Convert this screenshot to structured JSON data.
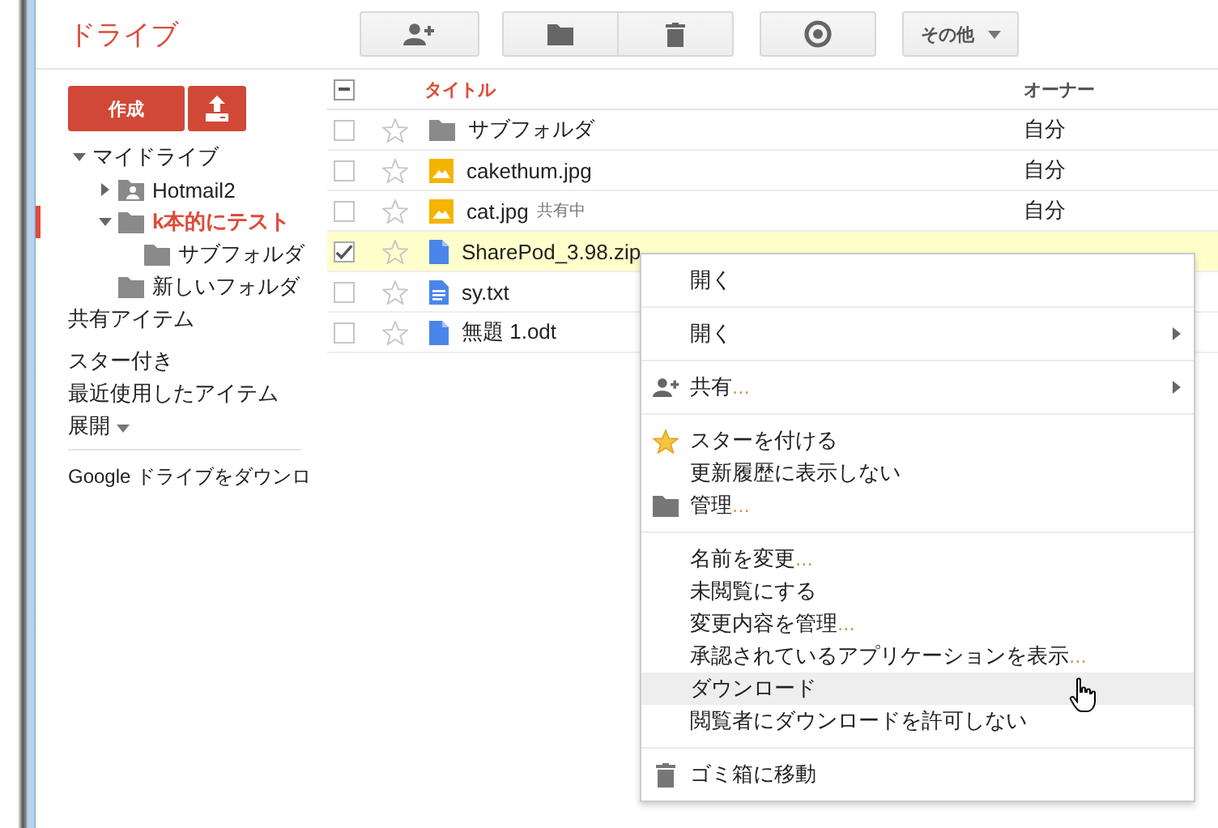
{
  "app": {
    "title": "ドライブ"
  },
  "toolbar": [
    {
      "kind": "share"
    },
    {
      "kind": "folder"
    },
    {
      "kind": "trash"
    },
    {
      "kind": "preview"
    },
    {
      "kind": "more",
      "label": "その他"
    }
  ],
  "sidebar": {
    "create_button": "作成",
    "tree": [
      {
        "label": "マイドライブ",
        "expanded": true,
        "selected": false,
        "children": [
          {
            "label": "Hotmail2",
            "kind": "shared-folder",
            "expanded": false,
            "selected": false
          },
          {
            "label": "k本的にテスト",
            "kind": "folder",
            "expanded": true,
            "selected": true,
            "children": [
              {
                "label": "サブフォルダ",
                "kind": "folder",
                "selected": false
              }
            ]
          },
          {
            "label": "新しいフォルダ",
            "kind": "folder",
            "selected": false
          }
        ]
      }
    ],
    "links": [
      {
        "label": "共有アイテム"
      },
      {
        "label": "スター付き"
      },
      {
        "label": "最近使用したアイテム"
      }
    ],
    "expand": "展開",
    "download": "Google ドライブをダウンロ"
  },
  "table": {
    "columns": [
      "タイトル",
      "オーナー"
    ],
    "select_all_partial": true,
    "rows": [
      {
        "kind": "folder",
        "name": "サブフォルダ",
        "owner": "自分",
        "checked": false,
        "starred": false
      },
      {
        "kind": "image",
        "name": "cakethum.jpg",
        "owner": "自分",
        "checked": false,
        "starred": false
      },
      {
        "kind": "image",
        "name": "cat.jpg",
        "tag": "共有中",
        "owner": "自分",
        "checked": false,
        "starred": false
      },
      {
        "kind": "file",
        "name": "SharePod_3.98.zip",
        "checked": true,
        "starred": false
      },
      {
        "kind": "doc",
        "name": "sy.txt",
        "checked": false,
        "starred": false
      },
      {
        "kind": "file",
        "name": "無題 1.odt",
        "checked": false,
        "starred": false
      }
    ]
  },
  "context_menu": [
    [
      {
        "label": "開く",
        "kind": "plain",
        "submenu": false,
        "hovered": false
      }
    ],
    [
      {
        "label": "開く",
        "kind": "plain",
        "submenu": true,
        "hovered": false
      }
    ],
    [
      {
        "label": "共有",
        "suffix": "...",
        "kind": "share",
        "submenu": true,
        "hovered": false
      }
    ],
    [
      {
        "label": "スターを付ける",
        "kind": "star",
        "submenu": false,
        "hovered": false
      },
      {
        "label": "更新履歴に表示しない",
        "kind": "plain",
        "submenu": false,
        "hovered": false
      },
      {
        "label": "管理",
        "suffix": "...",
        "kind": "folder",
        "submenu": false,
        "hovered": false
      }
    ],
    [
      {
        "label": "名前を変更",
        "suffix": "...",
        "kind": "plain",
        "submenu": false,
        "hovered": false
      },
      {
        "label": "未閲覧にする",
        "kind": "plain",
        "submenu": false,
        "hovered": false
      },
      {
        "label": "変更内容を管理",
        "suffix": "...",
        "kind": "plain",
        "submenu": false,
        "hovered": false
      },
      {
        "label": "承認されているアプリケーションを表示",
        "suffix": "...",
        "kind": "plain",
        "submenu": false,
        "hovered": false
      },
      {
        "label": "ダウンロード",
        "kind": "plain",
        "submenu": false,
        "hovered": true
      },
      {
        "label": "閲覧者にダウンロードを許可しない",
        "kind": "plain",
        "submenu": false,
        "hovered": false
      }
    ],
    [
      {
        "label": "ゴミ箱に移動",
        "kind": "trash",
        "submenu": false,
        "hovered": false
      }
    ]
  ]
}
